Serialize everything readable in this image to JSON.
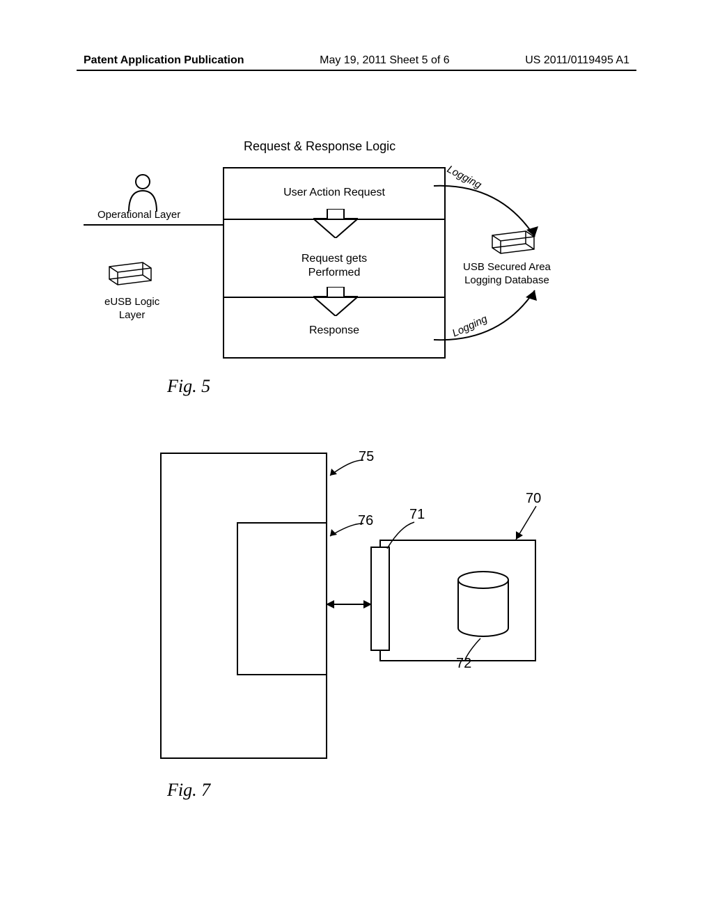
{
  "header": {
    "left": "Patent Application Publication",
    "mid": "May 19, 2011  Sheet 5 of 6",
    "right": "US 2011/0119495 A1"
  },
  "fig5": {
    "title": "Request & Response Logic",
    "cell1": "User Action Request",
    "cell2": "Request gets\nPerformed",
    "cell3": "Response",
    "operational_layer": "Operational Layer",
    "eusb_layer": "eUSB Logic\nLayer",
    "db_label": "USB Secured Area\nLogging Database",
    "logging_top": "Logging",
    "logging_bot": "Logging",
    "caption": "Fig. 5"
  },
  "fig7": {
    "ref75": "75",
    "ref76": "76",
    "ref70": "70",
    "ref71": "71",
    "ref72": "72",
    "caption": "Fig. 7"
  }
}
